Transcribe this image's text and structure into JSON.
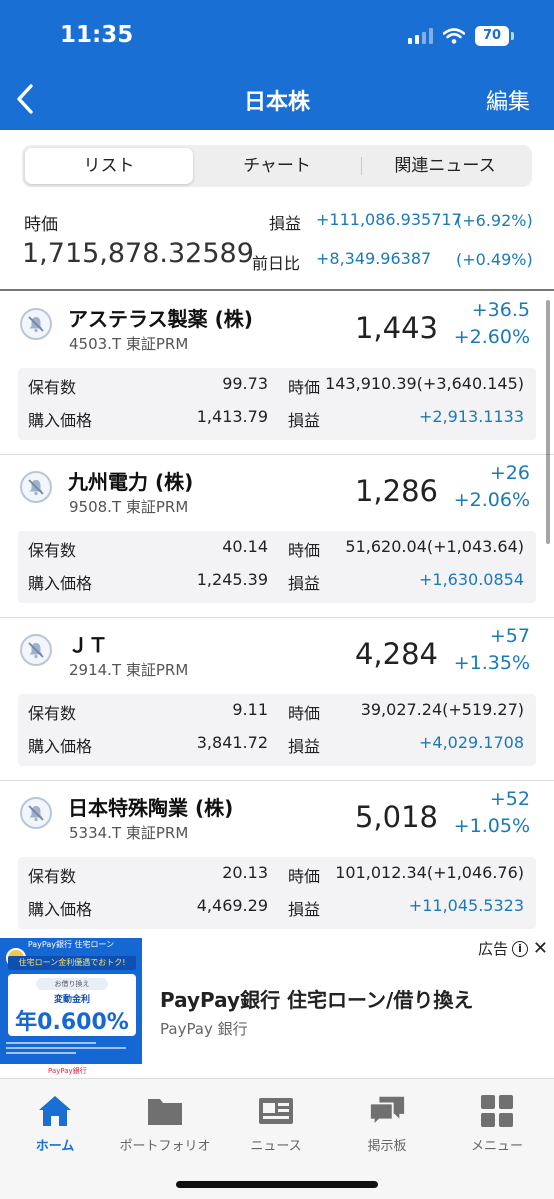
{
  "status_bar": {
    "time": "11:35",
    "battery": "70"
  },
  "nav": {
    "title": "日本株",
    "edit": "編集"
  },
  "segments": [
    "リスト",
    "チャート",
    "関連ニュース"
  ],
  "summary": {
    "market_value_label": "時価",
    "market_value": "1,715,878.32589",
    "pl_label": "損益",
    "pl_value": "+111,086.935717",
    "pl_pct": "(+6.92%)",
    "day_label": "前日比",
    "day_value": "+8,349.96387",
    "day_pct": "(+0.49%)"
  },
  "labels": {
    "qty": "保有数",
    "buy_price": "購入価格",
    "market_value": "時価",
    "pl": "損益"
  },
  "stocks": [
    {
      "name": "アステラス製薬 (株)",
      "code": "4503.T 東証PRM",
      "price": "1,443",
      "change": "+36.5",
      "change_pct": "+2.60%",
      "qty": "99.73",
      "buy_price": "1,413.79",
      "market_value": "143,910.39(+3,640.145)",
      "pl": "+2,913.1133"
    },
    {
      "name": "九州電力 (株)",
      "code": "9508.T 東証PRM",
      "price": "1,286",
      "change": "+26",
      "change_pct": "+2.06%",
      "qty": "40.14",
      "buy_price": "1,245.39",
      "market_value": "51,620.04(+1,043.64)",
      "pl": "+1,630.0854"
    },
    {
      "name": "ＪＴ",
      "code": "2914.T 東証PRM",
      "price": "4,284",
      "change": "+57",
      "change_pct": "+1.35%",
      "qty": "9.11",
      "buy_price": "3,841.72",
      "market_value": "39,027.24(+519.27)",
      "pl": "+4,029.1708"
    },
    {
      "name": "日本特殊陶業 (株)",
      "code": "5334.T 東証PRM",
      "price": "5,018",
      "change": "+52",
      "change_pct": "+1.05%",
      "qty": "20.13",
      "buy_price": "4,469.29",
      "market_value": "101,012.34(+1,046.76)",
      "pl": "+11,045.5323"
    }
  ],
  "ad": {
    "tag": "広告",
    "title": "PayPay銀行 住宅ローン/借り換え",
    "sponsor": "PayPay 銀行",
    "image_header": "PayPay銀行 住宅ローン",
    "image_banner": "住宅ローン金利優遇でおトク!",
    "image_card_sub": "お借り換え",
    "image_card_title": "変動金利",
    "image_rate": "年0.600%",
    "image_logo": "PayPay銀行"
  },
  "tabs": [
    {
      "label": "ホーム",
      "icon": "home-icon"
    },
    {
      "label": "ポートフォリオ",
      "icon": "folder-icon"
    },
    {
      "label": "ニュース",
      "icon": "news-icon"
    },
    {
      "label": "掲示板",
      "icon": "chat-icon"
    },
    {
      "label": "メニュー",
      "icon": "grid-icon"
    }
  ],
  "colors": {
    "header": "#1a6fd4",
    "positive": "#1a7ab8",
    "active_tab": "#1a6fd4"
  }
}
